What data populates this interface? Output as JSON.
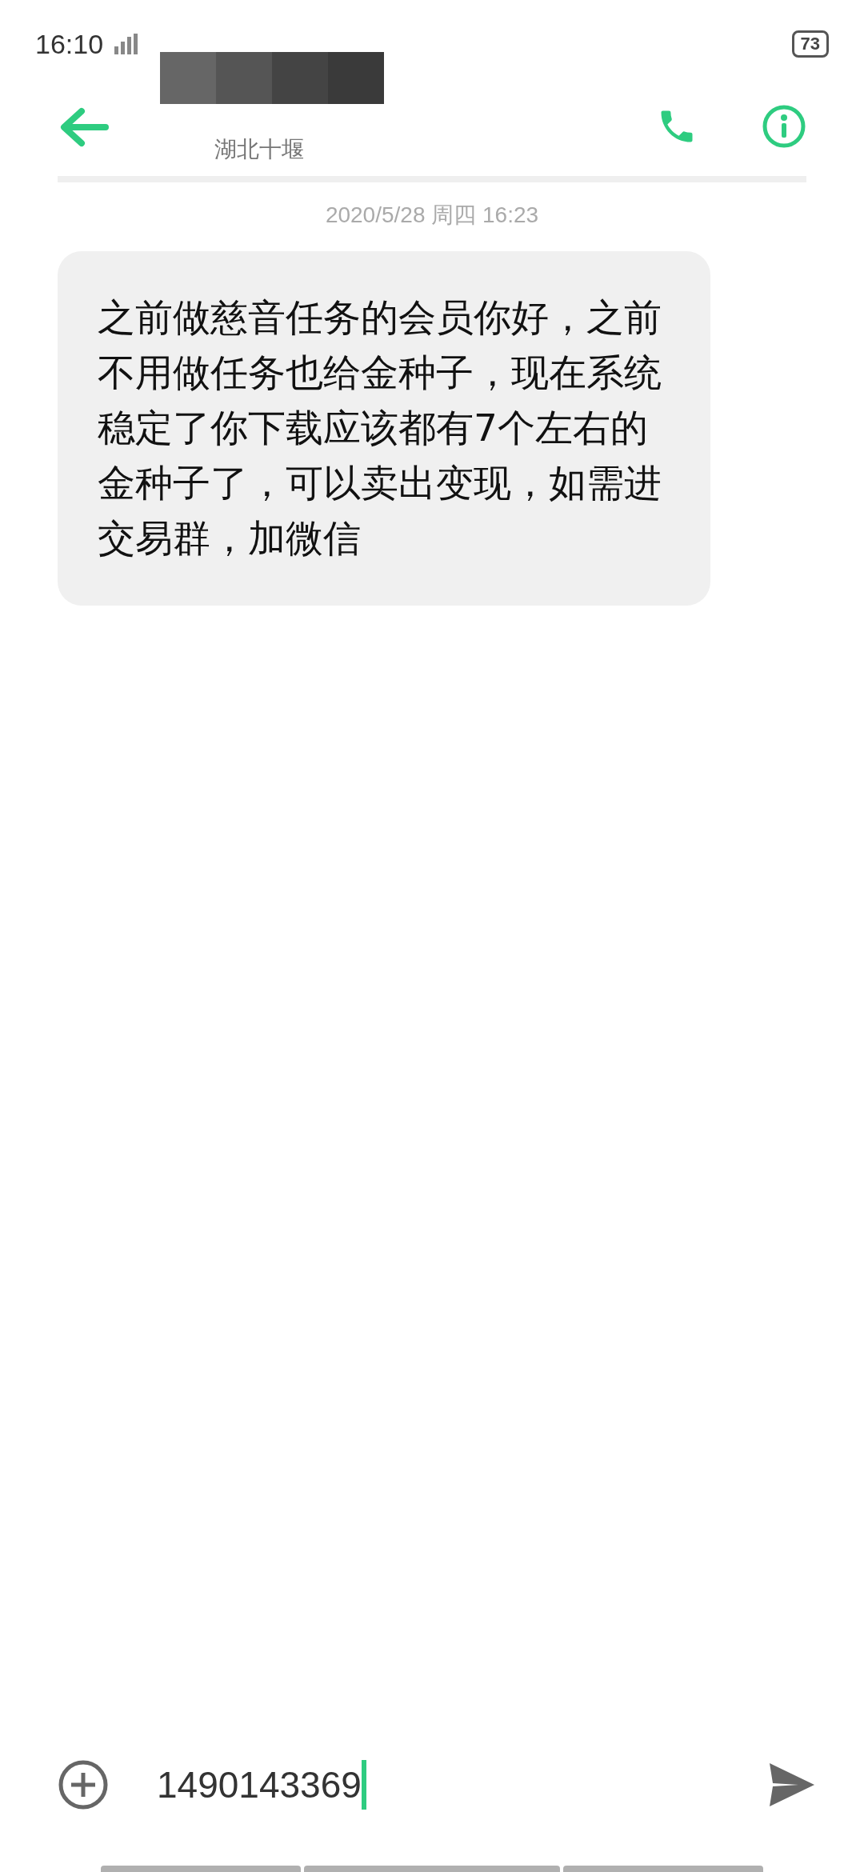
{
  "status_bar": {
    "time": "16:10",
    "battery": "73"
  },
  "header": {
    "subtitle": "湖北十堰"
  },
  "timestamp": "2020/5/28 周四 16:23",
  "messages": [
    {
      "kind": "incoming",
      "text": "之前做慈音任务的会员你好，之前不用做任务也给金种子，现在系统稳定了你下载应该都有7个左右的金种子了，可以卖出变现，如需进交易群，加微信"
    }
  ],
  "composer": {
    "value": "1490143369"
  }
}
